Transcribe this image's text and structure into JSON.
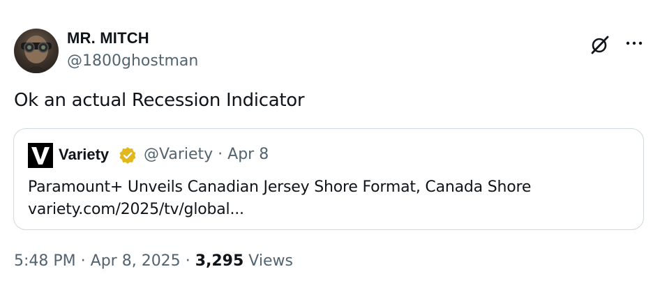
{
  "author": {
    "display_name": "MR. MITCH",
    "handle": "@1800ghostman"
  },
  "tweet": {
    "text": "Ok an actual Recession Indicator"
  },
  "quoted": {
    "display_name": "Variety",
    "handle": "@Variety",
    "separator": "·",
    "date": "Apr 8",
    "headline": "Paramount+ Unveils Canadian Jersey Shore Format, Canada Shore",
    "link": "variety.com/2025/tv/global..."
  },
  "footer": {
    "time": "5:48 PM",
    "separator": "·",
    "date": "Apr 8, 2025",
    "separator2": "·",
    "views_count": "3,295",
    "views_label": "Views"
  },
  "colors": {
    "text": "#0f1419",
    "muted": "#536471",
    "border": "#cfd9de",
    "verified_gold": "#e2b719"
  },
  "icons": {
    "grok": "grok-icon",
    "more": "more-icon",
    "verified": "verified-badge-icon"
  }
}
